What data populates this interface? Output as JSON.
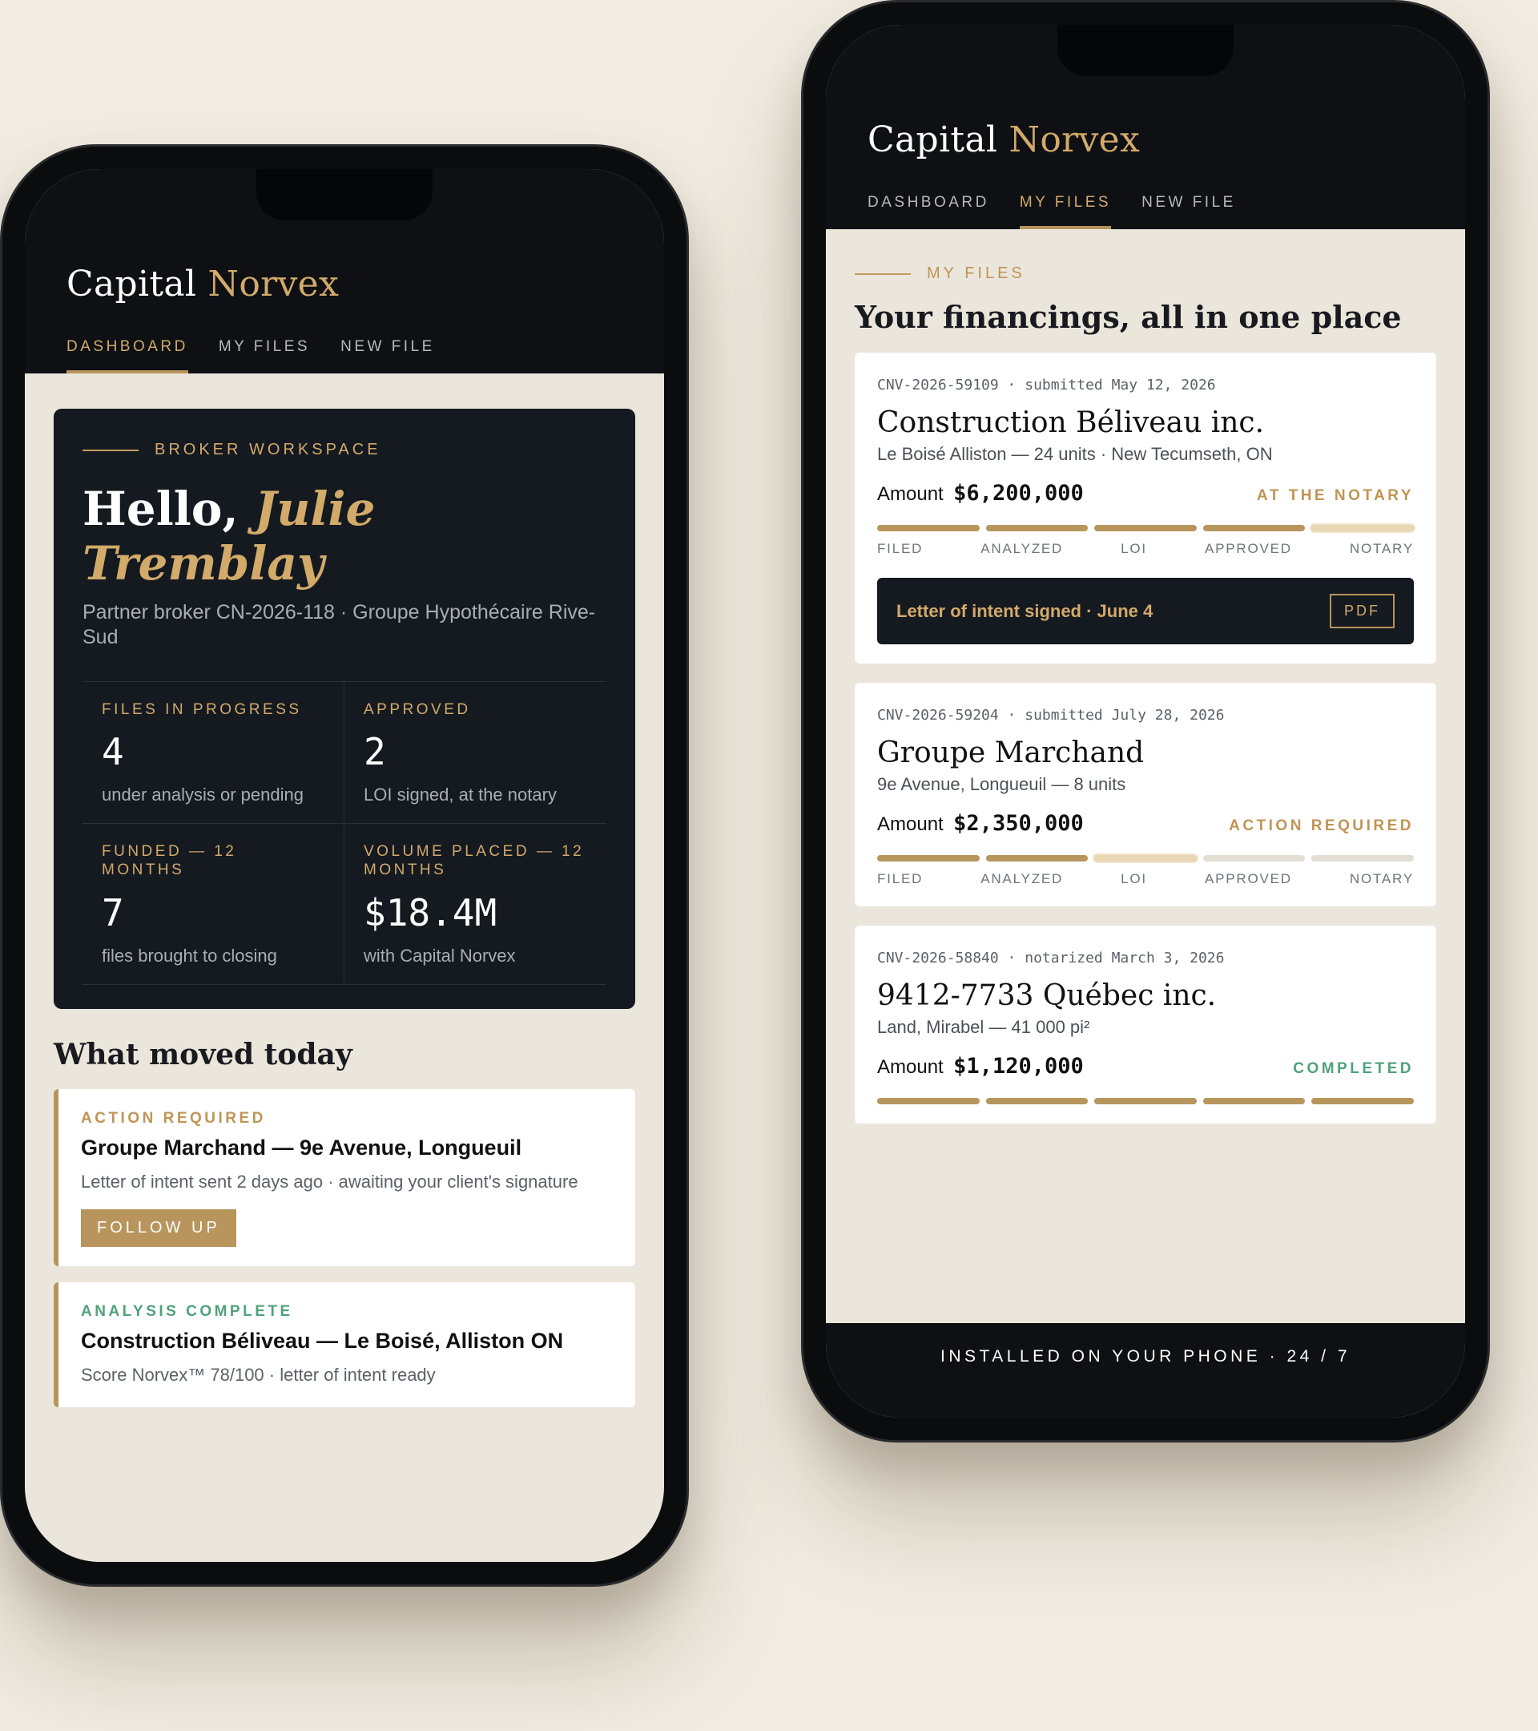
{
  "brand": {
    "name_main": "Capital",
    "name_accent": "Norvex"
  },
  "nav": [
    "DASHBOARD",
    "MY FILES",
    "NEW FILE"
  ],
  "dashboard": {
    "eyebrow": "BROKER WORKSPACE",
    "greeting": "Hello,",
    "user_name": "Julie Tremblay",
    "subtitle": "Partner broker CN-2026-118 · Groupe Hypothécaire Rive-Sud",
    "stats": [
      {
        "label": "FILES IN PROGRESS",
        "value": "4",
        "note": "under analysis or pending"
      },
      {
        "label": "APPROVED",
        "value": "2",
        "note": "LOI signed, at the notary"
      },
      {
        "label": "FUNDED — 12 MONTHS",
        "value": "7",
        "note": "files brought to closing"
      },
      {
        "label": "VOLUME PLACED — 12 MONTHS",
        "value": "$18.4M",
        "note": "with Capital Norvex"
      }
    ],
    "section_title": "What moved today",
    "activities": [
      {
        "tag": "ACTION REQUIRED",
        "title": "Groupe Marchand — 9e Avenue, Longueuil",
        "desc": "Letter of intent sent 2 days ago · awaiting your client's signature",
        "button": "FOLLOW UP"
      },
      {
        "tag": "ANALYSIS COMPLETE",
        "title": "Construction Béliveau — Le Boisé, Alliston ON",
        "desc": "Score Norvex™ 78/100 · letter of intent ready"
      }
    ]
  },
  "files": {
    "eyebrow": "MY FILES",
    "title": "Your financings, all in one place",
    "amount_label": "Amount",
    "steps": [
      "FILED",
      "ANALYZED",
      "LOI",
      "APPROVED",
      "NOTARY"
    ],
    "items": [
      {
        "meta": "CNV-2026-59109 · submitted May 12, 2026",
        "name": "Construction Béliveau inc.",
        "address": "Le Boisé Alliston — 24 units · New Tecumseth, ON",
        "amount": "$6,200,000",
        "status": "AT THE NOTARY",
        "progress_completed_steps": 4,
        "current_step": 5,
        "doc_text": "Letter of intent signed · June 4",
        "doc_button": "PDF"
      },
      {
        "meta": "CNV-2026-59204 · submitted July 28, 2026",
        "name": "Groupe Marchand",
        "address": "9e Avenue, Longueuil — 8 units",
        "amount": "$2,350,000",
        "status": "ACTION REQUIRED",
        "progress_completed_steps": 2,
        "current_step": 3
      },
      {
        "meta": "CNV-2026-58840 · notarized March 3, 2026",
        "name": "9412-7733 Québec inc.",
        "address": "Land, Mirabel — 41 000 pi²",
        "amount": "$1,120,000",
        "status": "COMPLETED",
        "progress_completed_steps": 5,
        "current_step": 0
      }
    ],
    "footer": "INSTALLED ON YOUR PHONE · 24 / 7"
  },
  "colors": {
    "gold": "#b8955c",
    "gold_text": "#d2aa6a",
    "dark": "#0e1014",
    "green": "#4fa27a",
    "cream": "#ebe6db"
  }
}
